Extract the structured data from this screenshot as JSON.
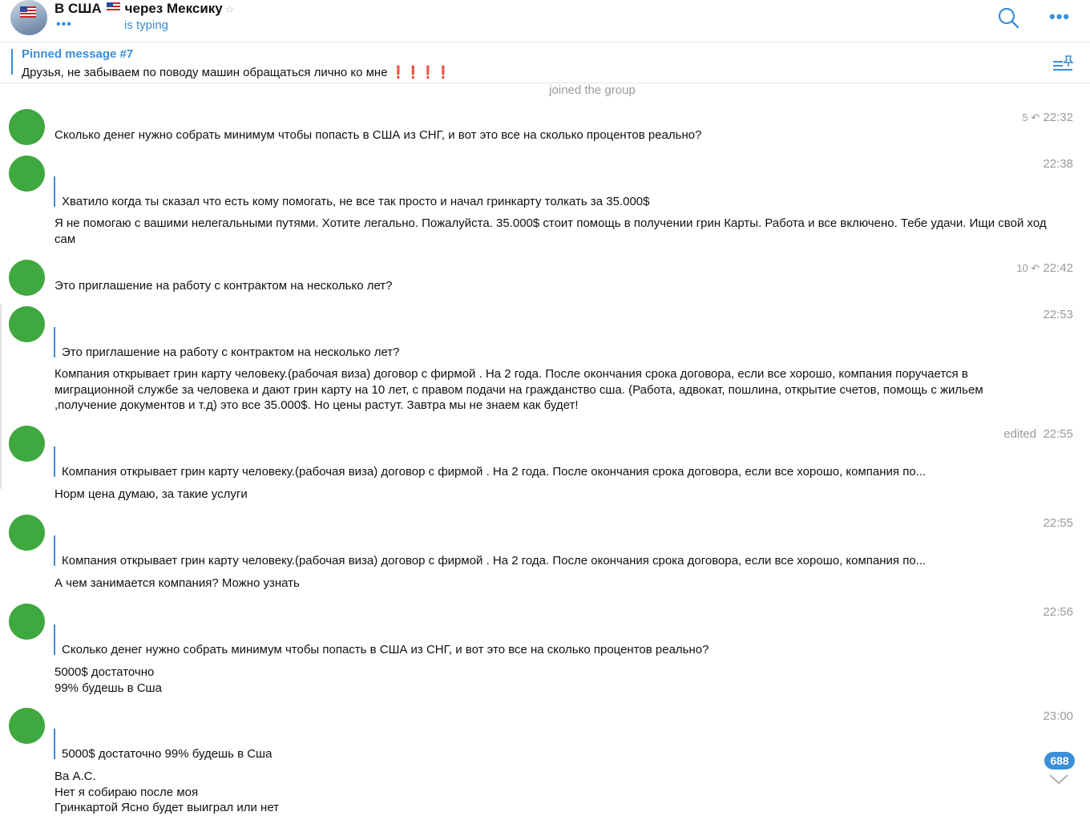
{
  "header": {
    "title_part1": "В США",
    "title_part2": "через Мексику",
    "typing_dots": "•••",
    "status": "is typing",
    "mute_symbol": "☆"
  },
  "pinned": {
    "title": "Pinned message #7",
    "text": "Друзья, не забываем по поводу машин обращаться лично ко мне",
    "marks": "❗❗❗❗"
  },
  "service_message": "joined the group",
  "messages": [
    {
      "meta_prefix": "5 ↶",
      "time": "22:32",
      "quote": "",
      "text": "Сколько денег нужно собрать минимум чтобы попасть в США из СНГ, и вот это все на сколько процентов реально?"
    },
    {
      "meta_prefix": "",
      "time": "22:38",
      "quote": "Хватило когда ты сказал что есть кому помогать, не все так просто и начал гринкарту толкать за 35.000$",
      "text": "Я не помогаю с вашими нелегальными путями. Хотите легально. Пожалуйста. 35.000$ стоит помощь в получении грин Карты. Работа и все включено. Тебе удачи. Ищи свой ход сам"
    },
    {
      "meta_prefix": "10 ↶",
      "time": "22:42",
      "quote": "",
      "text": "Это приглашение на работу с контрактом на несколько лет?"
    },
    {
      "meta_prefix": "",
      "time": "22:53",
      "quote": "Это приглашение на работу с контрактом на несколько лет?",
      "text": "Компания открывает грин карту человеку.(рабочая виза) договор с фирмой . На 2 года. После окончания срока договора, если все хорошо, компания поручается в миграционной службе за человека и дают грин карту на 10 лет, с правом подачи на гражданство сша.  (Работа, адвокат, пошлина,  открытие счетов, помощь с жильем ,получение документов и т.д) это все 35.000$. Но цены растут. Завтра мы не знаем как будет!"
    },
    {
      "meta_prefix": "edited",
      "time": "22:55",
      "quote": "Компания открывает грин карту человеку.(рабочая виза) договор с фирмой . На 2 года. После окончания срока договора, если все хорошо, компания по...",
      "text": "Норм цена думаю, за такие услуги"
    },
    {
      "meta_prefix": "",
      "time": "22:55",
      "quote": "Компания открывает грин карту человеку.(рабочая виза) договор с фирмой . На 2 года. После окончания срока договора, если все хорошо, компания по...",
      "text": "А чем занимается компания? Можно узнать"
    },
    {
      "meta_prefix": "",
      "time": "22:56",
      "quote": "Сколько денег нужно собрать минимум чтобы попасть в США из СНГ, и вот это все на сколько процентов реально?",
      "text_lines": [
        "5000$ достаточно",
        "99% будешь в Сша"
      ]
    },
    {
      "meta_prefix": "",
      "time": "23:00",
      "quote": "5000$ достаточно  99% будешь в Сша",
      "text_lines": [
        "Ва А.С.",
        "Нет я собираю после моя",
        "Гринкартой Ясно  будет выиграл или нет"
      ]
    }
  ],
  "unread_badge": "688"
}
